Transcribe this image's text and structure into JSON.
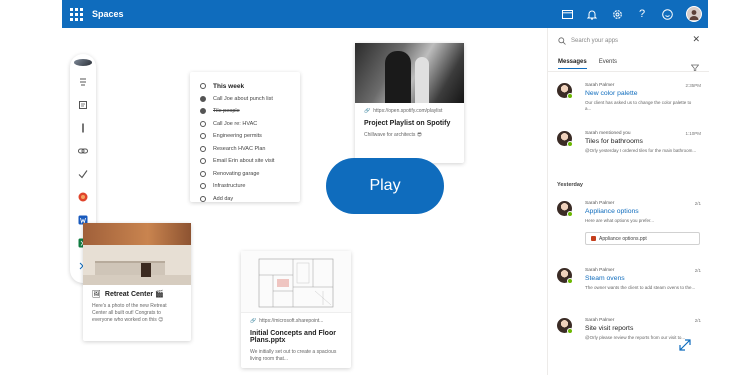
{
  "topbar": {
    "title": "Spaces",
    "bg_color": "#0f6cbd",
    "icons": [
      "waffle-icon",
      "calendar-icon",
      "bell-icon",
      "settings-icon",
      "help-icon",
      "smile-icon",
      "avatar"
    ]
  },
  "rail": {
    "icons": [
      "avatar",
      "home-icon",
      "notes-icon",
      "pen-icon",
      "link-icon",
      "check-icon",
      "sticker-icon",
      "word-icon",
      "excel-icon",
      "expand-icon"
    ]
  },
  "todo": {
    "header": "This week",
    "items": [
      {
        "text": "Call Joe about punch list",
        "done": true,
        "strike": false
      },
      {
        "text": "Tile people",
        "done": true,
        "strike": true
      },
      {
        "text": "Call Joe re: HVAC",
        "done": false,
        "strike": false
      },
      {
        "text": "Engineering permits",
        "done": false,
        "strike": false
      },
      {
        "text": "Research HVAC Plan",
        "done": false,
        "strike": false
      },
      {
        "text": "Email Erin about site visit",
        "done": false,
        "strike": false
      },
      {
        "text": "Renovating garage",
        "done": false,
        "strike": false
      },
      {
        "text": "Infrastructure",
        "done": false,
        "strike": false
      },
      {
        "text": "Add day",
        "done": false,
        "strike": false
      }
    ]
  },
  "playlist": {
    "url": "https://open.spotify.com/playlist",
    "title": "Project Playlist on Spotify",
    "sub": "Chillwave for architects 😎"
  },
  "play_button": {
    "label": "Play",
    "color": "#0f6cbd"
  },
  "retreat": {
    "title": "Retreat Center 🎬",
    "body": "Here's a photo of the new Retreat Center all built out! Congrats to everyone who worked on this 😊"
  },
  "plans": {
    "url": "https://microsoft.sharepoint...",
    "title": "Initial Concepts and Floor Plans.pptx",
    "body": "We initially set out to create a spacious living room that..."
  },
  "pane": {
    "search_placeholder": "Search your apps",
    "tabs": [
      "Messages",
      "Events"
    ],
    "active_tab": "Messages",
    "section_yesterday": "Yesterday",
    "messages": [
      {
        "from": "Sarah Palmer",
        "when": "2:35PM",
        "subject": "New color palette",
        "subject_is_link": true,
        "body": "Our client has asked us to change the color palette to a...",
        "attachment": null
      },
      {
        "from": "Sarah mentioned you",
        "when": "1:10PM",
        "subject": "Tiles for bathrooms",
        "subject_is_link": false,
        "body": "@Orly yesterday I ordered tiles for the main bathroom...",
        "attachment": null
      },
      {
        "from": "Sarah Palmer",
        "when": "2/1",
        "subject": "Appliance options",
        "subject_is_link": true,
        "body": "Here are what options you prefer...",
        "attachment": "Appliance options.ppt"
      },
      {
        "from": "Sarah Palmer",
        "when": "2/1",
        "subject": "Steam ovens",
        "subject_is_link": true,
        "body": "The owner wants the client to add steam ovens to the...",
        "attachment": null
      },
      {
        "from": "Sarah Palmer",
        "when": "2/1",
        "subject": "Site visit reports",
        "subject_is_link": false,
        "body": "@Orly please review the reports from our visit to...",
        "attachment": null
      }
    ]
  }
}
